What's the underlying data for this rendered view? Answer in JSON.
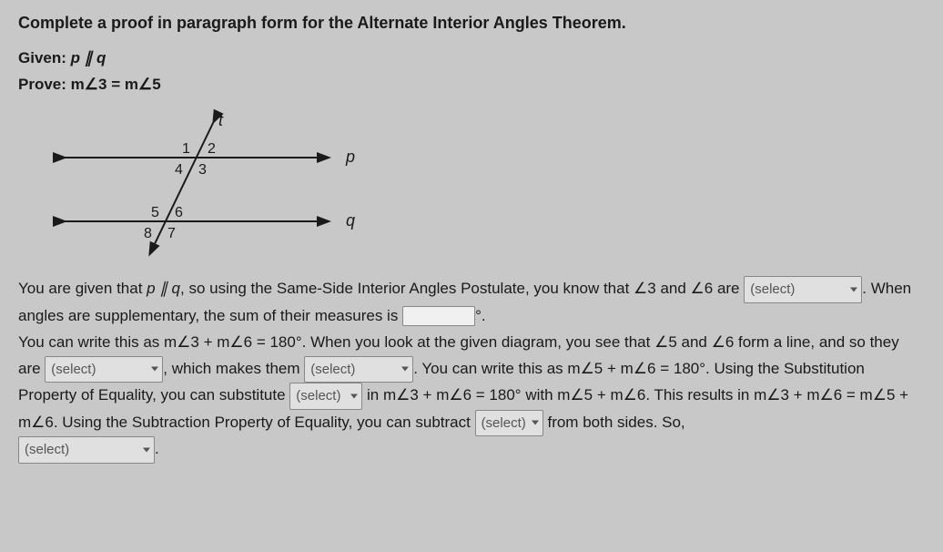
{
  "title": "Complete a proof in paragraph form for the Alternate Interior Angles Theorem.",
  "given_label": "Given:",
  "given_text": "p ∥ q",
  "prove_label": "Prove:",
  "prove_text": "m∠3 = m∠5",
  "diagram": {
    "line_t": "t",
    "line_p": "p",
    "line_q": "q",
    "a1": "1",
    "a2": "2",
    "a3": "3",
    "a4": "4",
    "a5": "5",
    "a6": "6",
    "a7": "7",
    "a8": "8"
  },
  "para": {
    "t1": "You are given that ",
    "t2": "p ∥ q",
    "t3": ", so using the Same-Side Interior Angles Postulate, you know that ∠3 and ∠6 are ",
    "select1": "(select)",
    "t4": ". When angles are supplementary, the sum of their measures is ",
    "degree": "°.",
    "t5": "You can write this as m∠3 + m∠6 = 180°. When you look at the given diagram, you see that ∠5 and ∠6 form a line, and so they are ",
    "select2": "(select)",
    "t6": ", which makes them ",
    "select3": "(select)",
    "t7": ". You can write this as m∠5 + m∠6 = 180°. Using the Substitution Property of Equality, you can substitute ",
    "select4": "(select)",
    "t8": " in m∠3 + m∠6 = 180° with m∠5 + m∠6. This results in m∠3 + m∠6 = m∠5 + m∠6. Using the Subtraction Property of Equality, you can subtract ",
    "select5": "(select)",
    "t9": " from both sides. So, ",
    "select6": "(select)",
    "t10": "."
  }
}
